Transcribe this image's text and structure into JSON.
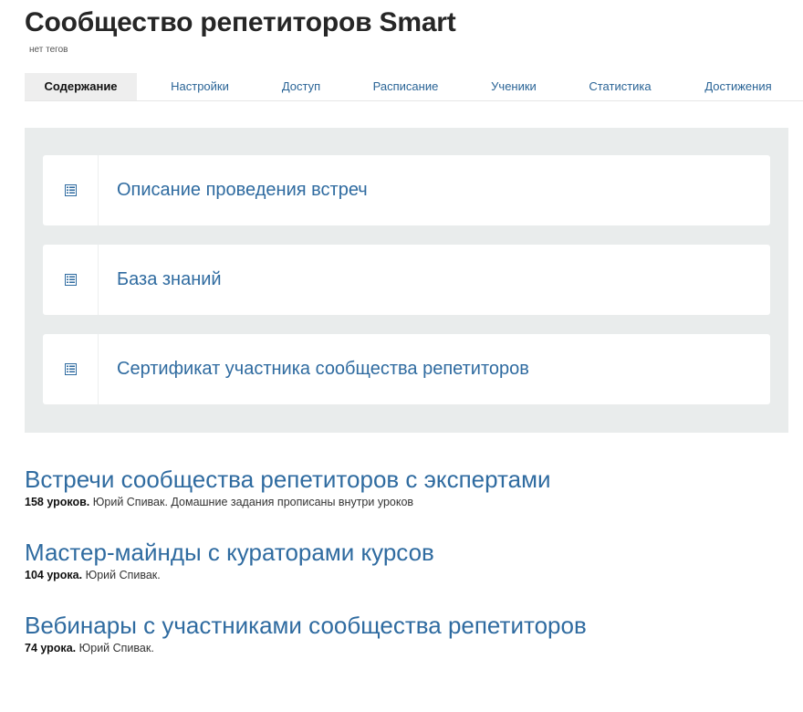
{
  "header": {
    "title": "Сообщество репетиторов Smart",
    "tags": "нет тегов"
  },
  "tabs": [
    {
      "label": "Содержание"
    },
    {
      "label": "Настройки"
    },
    {
      "label": "Доступ"
    },
    {
      "label": "Расписание"
    },
    {
      "label": "Ученики"
    },
    {
      "label": "Статистика"
    },
    {
      "label": "Достижения"
    }
  ],
  "outline": {
    "items": [
      {
        "label": "Описание проведения встреч",
        "icon": "document-list-icon"
      },
      {
        "label": "База знаний",
        "icon": "document-list-icon"
      },
      {
        "label": "Сертификат участника сообщества репетиторов",
        "icon": "document-list-icon"
      }
    ]
  },
  "sections": [
    {
      "title": "Встречи сообщества репетиторов с экспертами",
      "count": "158 уроков.",
      "details": "Юрий Спивак. Домашние задания прописаны внутри уроков"
    },
    {
      "title": "Мастер-майнды с кураторами курсов",
      "count": "104 урока.",
      "details": "Юрий Спивак."
    },
    {
      "title": "Вебинары с участниками сообщества репетиторов",
      "count": "74 урока.",
      "details": "Юрий Спивак."
    }
  ],
  "colors": {
    "link": "#2f6ba0",
    "panel_bg": "#e9ecec",
    "active_tab_bg": "#eeeeee"
  }
}
